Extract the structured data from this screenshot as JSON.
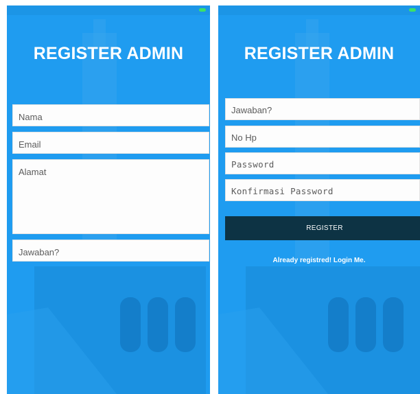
{
  "colors": {
    "accent": "#1f9cf0",
    "button": "#0d3344",
    "field_bg": "#fdfdfd"
  },
  "left_screen": {
    "title": "REGISTER ADMIN",
    "fields": {
      "nama": "Nama",
      "email": "Email",
      "alamat": "Alamat",
      "jawaban": "Jawaban?"
    }
  },
  "right_screen": {
    "title": "REGISTER ADMIN",
    "fields": {
      "jawaban": "Jawaban?",
      "no_hp": "No Hp",
      "password": "Password",
      "konfirmasi_password": "Konfirmasi Password"
    },
    "register_button": "REGISTER",
    "login_link": "Already registred! Login Me."
  },
  "icons": [
    "battery-icon"
  ]
}
